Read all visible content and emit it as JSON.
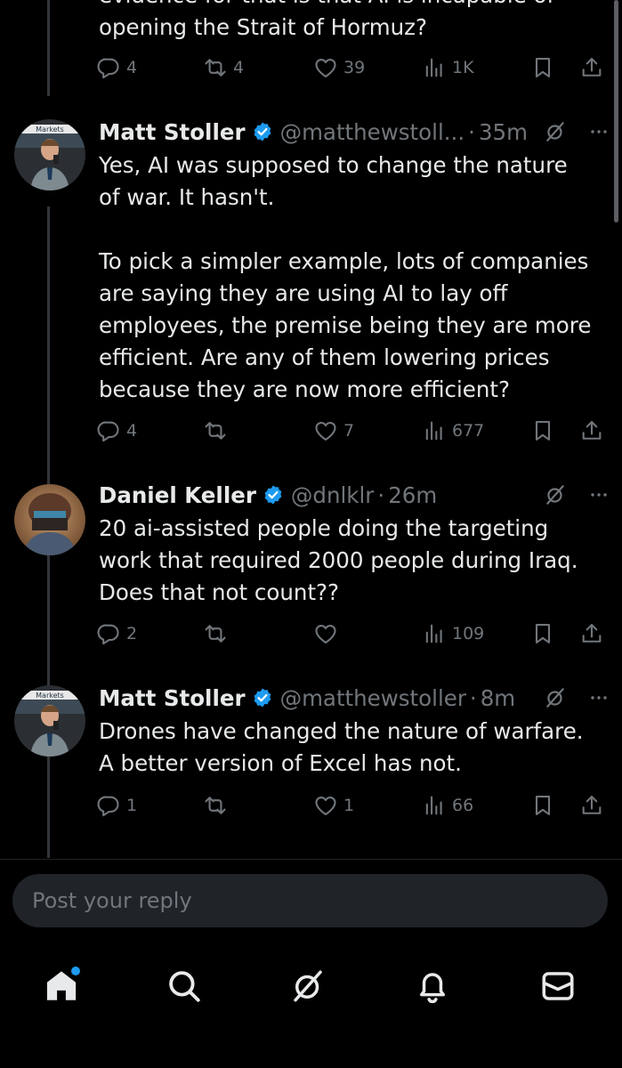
{
  "tweets": [
    {
      "text": "evidence for that is that AI is incapable of\nopening the Strait of Hormuz?",
      "replies": "4",
      "reposts": "4",
      "likes": "39",
      "views": "1K"
    },
    {
      "author": "Matt Stoller",
      "handle": "@matthewstoll...",
      "time": "35m",
      "text": "Yes, AI was supposed to change the nature\nof war. It hasn't.\n\nTo pick a simpler example, lots of companies\nare saying they are using AI to lay off\nemployees, the premise being they are more\nefficient. Are any of them lowering prices\nbecause they are now more efficient?",
      "replies": "4",
      "reposts": "",
      "likes": "7",
      "views": "677"
    },
    {
      "author": "Daniel Keller",
      "handle": "@dnlklr",
      "time": "26m",
      "text": "20 ai-assisted people doing the targeting\nwork that required 2000 people during Iraq.\nDoes that not count??",
      "replies": "2",
      "reposts": "",
      "likes": "",
      "views": "109"
    },
    {
      "author": "Matt Stoller",
      "handle": "@matthewstoller",
      "time": "8m",
      "text": "Drones have changed the nature of warfare.\nA better version of Excel has not.",
      "replies": "1",
      "reposts": "",
      "likes": "1",
      "views": "66"
    }
  ],
  "avatars": {
    "stoller_banner_text": "Markets"
  },
  "reply_bar": {
    "placeholder": "Post your reply"
  },
  "nav": {
    "items": [
      "home-icon",
      "search-icon",
      "grok-icon",
      "notifications-icon",
      "messages-icon"
    ],
    "home_has_notification": true
  },
  "colors": {
    "background": "#000000",
    "text": "#e7e9ea",
    "secondary": "#71767b",
    "accent": "#1d9bf0",
    "input_bg": "#202327"
  }
}
